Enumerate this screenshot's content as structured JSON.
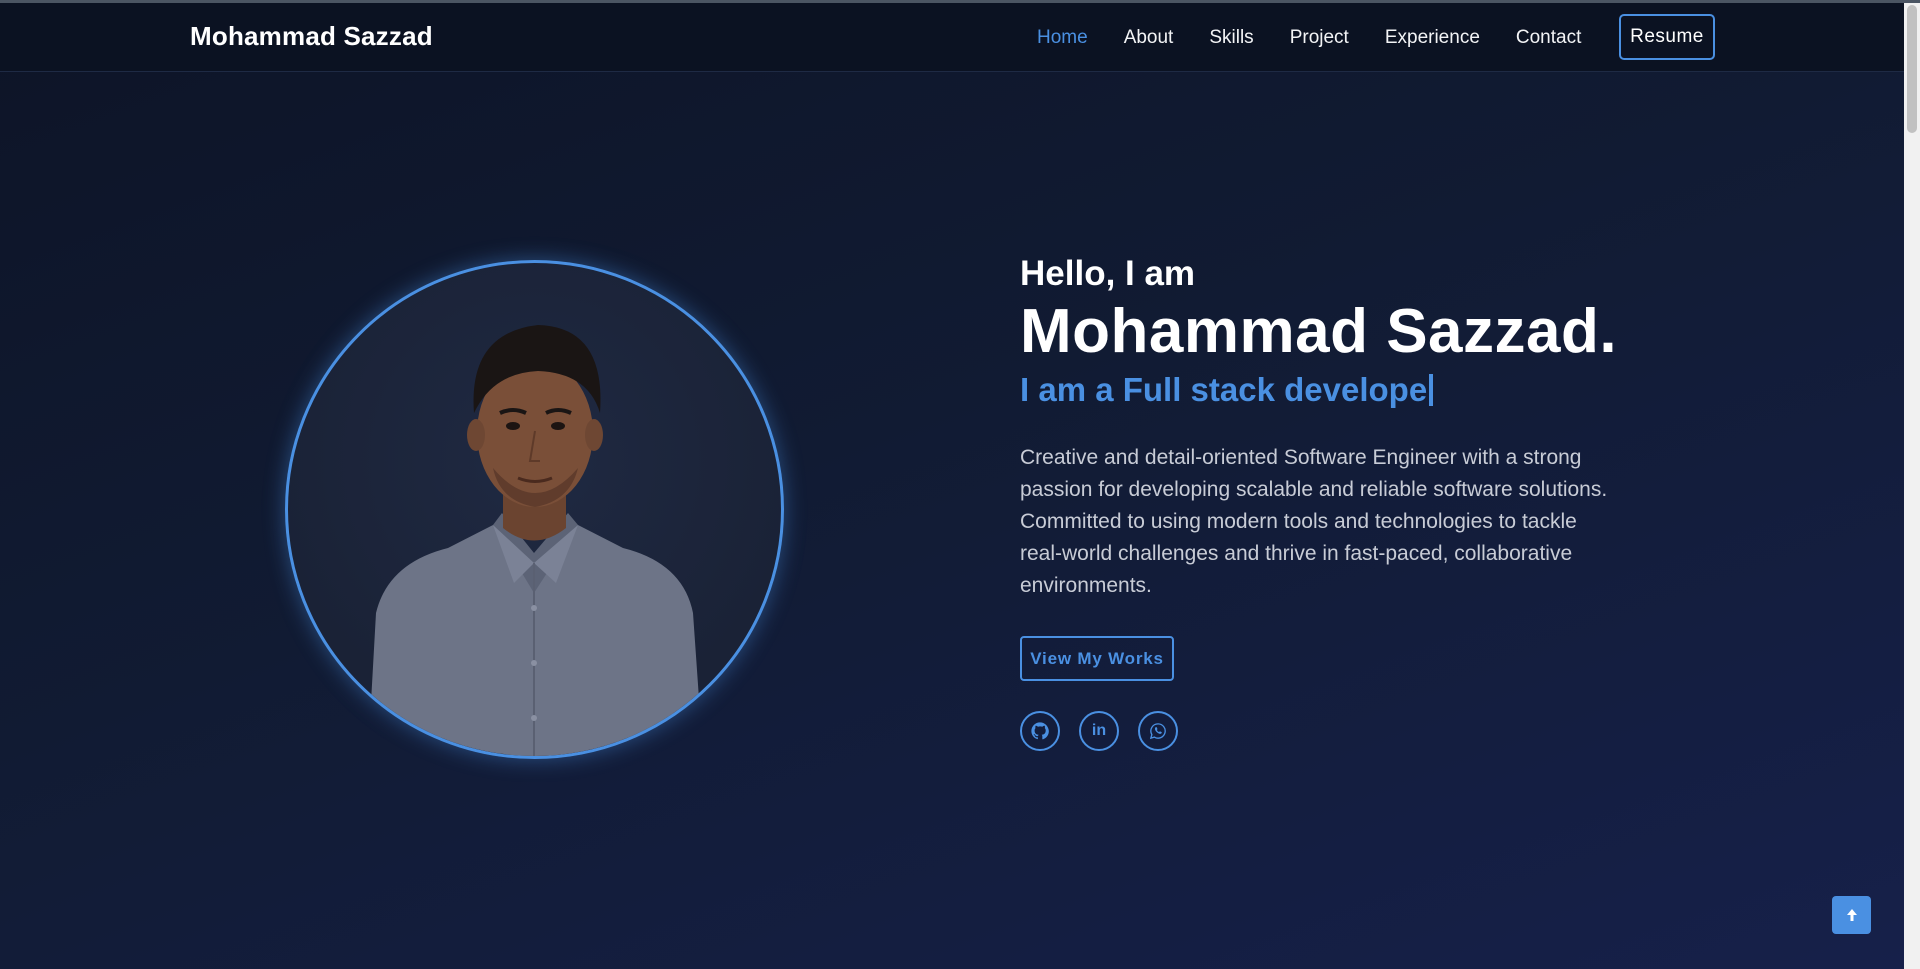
{
  "header": {
    "brand": "Mohammad Sazzad",
    "nav": [
      {
        "label": "Home",
        "active": true
      },
      {
        "label": "About",
        "active": false
      },
      {
        "label": "Skills",
        "active": false
      },
      {
        "label": "Project",
        "active": false
      },
      {
        "label": "Experience",
        "active": false
      },
      {
        "label": "Contact",
        "active": false
      }
    ],
    "resume_label": "Resume"
  },
  "hero": {
    "greeting": "Hello, I am",
    "name": "Mohammad Sazzad.",
    "tagline": "I am a Full stack develope",
    "bio": "Creative and detail-oriented Software Engineer with a strong passion for developing scalable and reliable software solutions. Committed to using modern tools and technologies to tackle real-world challenges and thrive in fast-paced, collaborative environments.",
    "cta_label": "View My Works",
    "socials": [
      {
        "icon": "github-icon"
      },
      {
        "icon": "linkedin-icon",
        "text": "in"
      },
      {
        "icon": "whatsapp-icon"
      }
    ]
  },
  "colors": {
    "accent": "#4a90e2",
    "background": "#0f1729",
    "navbar": "#0b1222"
  },
  "scroll_top": {
    "icon": "arrow-up-icon"
  }
}
